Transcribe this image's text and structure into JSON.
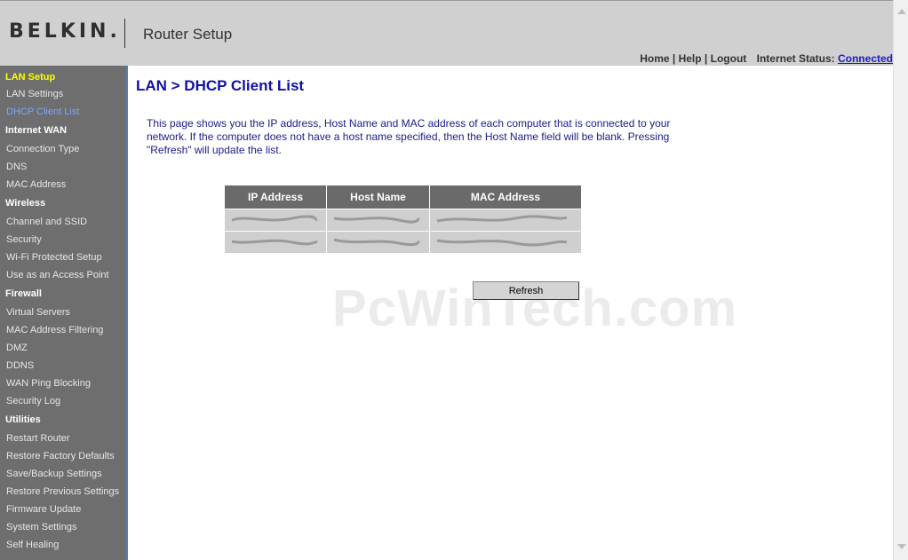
{
  "header": {
    "logo": "BELKIN.",
    "title": "Router Setup",
    "nav": {
      "home": "Home |",
      "help": "Help |",
      "logout": "Logout",
      "status_label": "Internet Status:",
      "status_value": "Connected"
    }
  },
  "sidebar": {
    "sections": [
      {
        "title": "LAN Setup",
        "items": [
          "LAN Settings",
          "DHCP Client List"
        ]
      },
      {
        "title": "Internet WAN",
        "items": [
          "Connection Type",
          "DNS",
          "MAC Address"
        ]
      },
      {
        "title": "Wireless",
        "items": [
          "Channel and SSID",
          "Security",
          "Wi-Fi Protected Setup",
          "Use as an Access Point"
        ]
      },
      {
        "title": "Firewall",
        "items": [
          "Virtual Servers",
          "MAC Address Filtering",
          "DMZ",
          "DDNS",
          "WAN Ping Blocking",
          "Security Log"
        ]
      },
      {
        "title": "Utilities",
        "items": [
          "Restart Router",
          "Restore Factory Defaults",
          "Save/Backup Settings",
          "Restore Previous Settings",
          "Firmware Update",
          "System Settings",
          "Self Healing"
        ]
      }
    ]
  },
  "main": {
    "title": "LAN > DHCP Client List",
    "description": "This page shows you the IP address, Host Name and MAC address of each computer that is connected to your network. If the computer does not have a host name specified, then the Host Name field will be blank. Pressing \"Refresh\" will update the list.",
    "table": {
      "headers": [
        "IP Address",
        "Host Name",
        "MAC Address"
      ]
    },
    "refresh_label": "Refresh",
    "watermark": "PcWinTech.com"
  },
  "colors": {
    "header_bg": "#d0d0d0",
    "sidebar_bg": "#6e6e6e",
    "active_section": "#ffff00",
    "active_item": "#7aa6ff",
    "title_blue": "#1010a8",
    "status_link": "#1a1acc"
  },
  "icons": {
    "scroll_up": "scroll-up-arrow-icon",
    "scroll_down": "scroll-down-arrow-icon"
  }
}
